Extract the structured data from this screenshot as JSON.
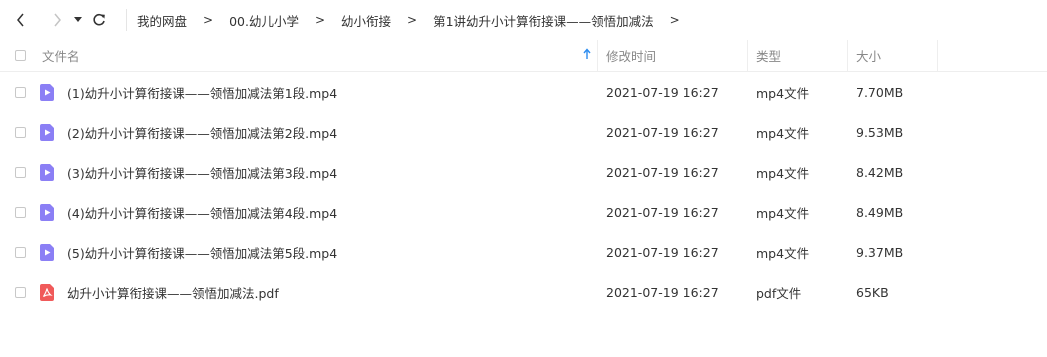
{
  "breadcrumb": {
    "items": [
      "我的网盘",
      "00.幼儿小学",
      "幼小衔接",
      "第1讲幼升小计算衔接课——领悟加减法"
    ],
    "separator": ">"
  },
  "nav": {
    "back_icon": "chevron-left-icon",
    "forward_icon": "chevron-right-icon",
    "history_icon": "caret-down-icon",
    "refresh_icon": "refresh-icon"
  },
  "table": {
    "headers": {
      "name": "文件名",
      "mtime": "修改时间",
      "type": "类型",
      "size": "大小"
    },
    "sort_icon": "sort-up-arrow-icon",
    "rows": [
      {
        "name": "(1)幼升小计算衔接课——领悟加减法第1段.mp4",
        "mtime": "2021-07-19 16:27",
        "type": "mp4文件",
        "size": "7.70MB",
        "icon": "video-file-icon"
      },
      {
        "name": "(2)幼升小计算衔接课——领悟加减法第2段.mp4",
        "mtime": "2021-07-19 16:27",
        "type": "mp4文件",
        "size": "9.53MB",
        "icon": "video-file-icon"
      },
      {
        "name": "(3)幼升小计算衔接课——领悟加减法第3段.mp4",
        "mtime": "2021-07-19 16:27",
        "type": "mp4文件",
        "size": "8.42MB",
        "icon": "video-file-icon"
      },
      {
        "name": "(4)幼升小计算衔接课——领悟加减法第4段.mp4",
        "mtime": "2021-07-19 16:27",
        "type": "mp4文件",
        "size": "8.49MB",
        "icon": "video-file-icon"
      },
      {
        "name": "(5)幼升小计算衔接课——领悟加减法第5段.mp4",
        "mtime": "2021-07-19 16:27",
        "type": "mp4文件",
        "size": "9.37MB",
        "icon": "video-file-icon"
      },
      {
        "name": "幼升小计算衔接课——领悟加减法.pdf",
        "mtime": "2021-07-19 16:27",
        "type": "pdf文件",
        "size": "65KB",
        "icon": "pdf-file-icon"
      }
    ]
  },
  "colors": {
    "video_icon": "#8b7ff5",
    "pdf_icon": "#f05a5a",
    "sort_arrow": "#2b8cf0"
  }
}
